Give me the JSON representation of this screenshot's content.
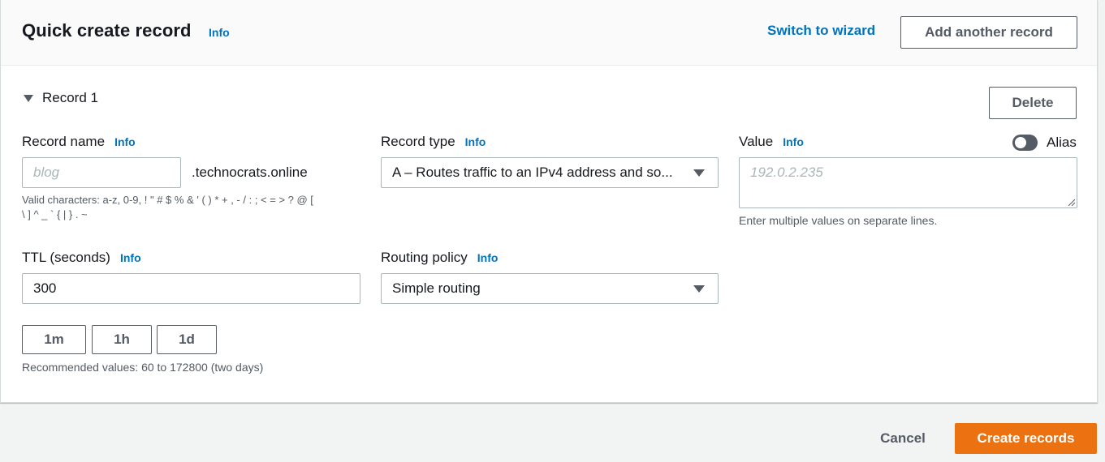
{
  "header": {
    "title": "Quick create record",
    "info_label": "Info",
    "switch_wizard_label": "Switch to wizard",
    "add_record_label": "Add another record"
  },
  "record": {
    "section_label": "Record 1",
    "delete_label": "Delete",
    "record_name": {
      "label": "Record name",
      "info_label": "Info",
      "placeholder": "blog",
      "value": "",
      "domain_suffix": ".technocrats.online",
      "hint_line1": "Valid characters: a-z, 0-9, ! \" # $ % & ' ( ) * + , - / : ; < = > ? @ [",
      "hint_line2": "\\ ] ^ _ ` { | } . ~"
    },
    "record_type": {
      "label": "Record type",
      "info_label": "Info",
      "selected": "A – Routes traffic to an IPv4 address and so..."
    },
    "value_field": {
      "label": "Value",
      "info_label": "Info",
      "placeholder": "192.0.2.235",
      "hint": "Enter multiple values on separate lines."
    },
    "alias": {
      "label": "Alias",
      "enabled": false
    },
    "ttl": {
      "label": "TTL (seconds)",
      "info_label": "Info",
      "value": "300",
      "presets": [
        "1m",
        "1h",
        "1d"
      ],
      "hint": "Recommended values: 60 to 172800 (two days)"
    },
    "routing_policy": {
      "label": "Routing policy",
      "info_label": "Info",
      "selected": "Simple routing"
    }
  },
  "footer": {
    "cancel_label": "Cancel",
    "create_label": "Create records"
  },
  "colors": {
    "link": "#0073bb",
    "primary": "#ec7211",
    "border": "#aab7b8",
    "text": "#16191f",
    "muted": "#545b64"
  }
}
